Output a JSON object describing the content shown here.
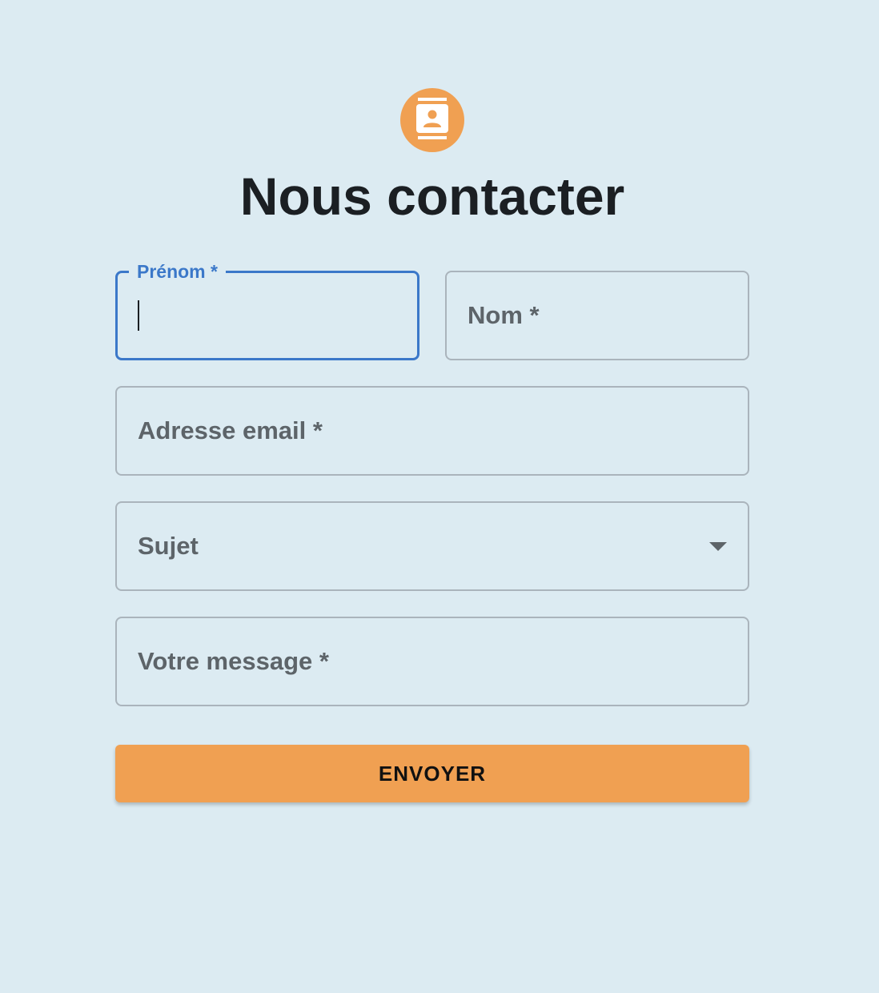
{
  "header": {
    "icon": "contact-card-icon",
    "title": "Nous contacter"
  },
  "form": {
    "first_name_label": "Prénom *",
    "last_name_label": "Nom *",
    "email_label": "Adresse email *",
    "subject_label": "Sujet",
    "message_label": "Votre message *",
    "submit_label": "ENVOYER"
  },
  "colors": {
    "background": "#dcebf2",
    "accent": "#f0a052",
    "focus": "#3b78c9",
    "text": "#1b1f23"
  }
}
